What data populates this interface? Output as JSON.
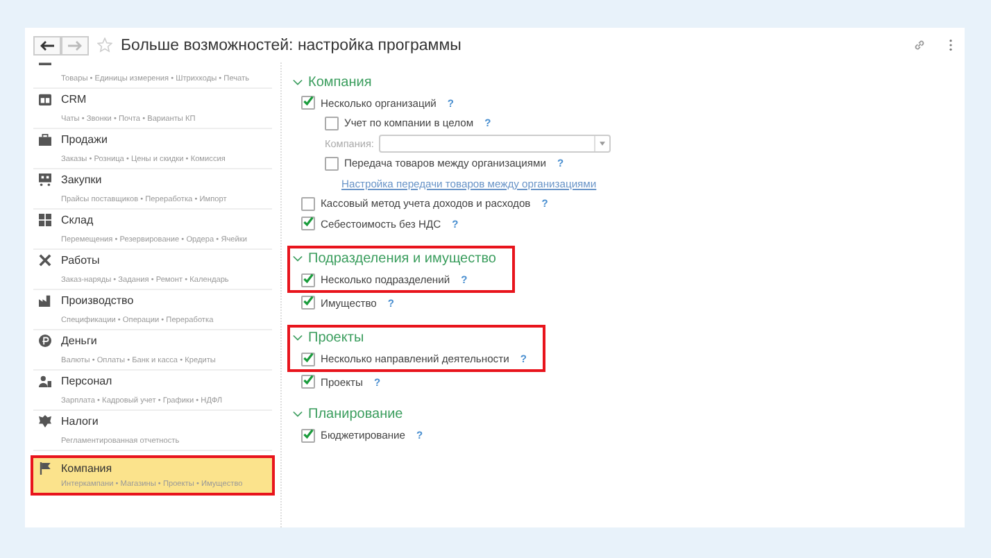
{
  "window": {
    "title": "Больше возможностей: настройка программы",
    "star": false
  },
  "sidebar": {
    "items": [
      {
        "subtitle": "Товары • Единицы измерения • Штрихкоды • Печать",
        "selected": false,
        "highlighted": false
      },
      {
        "title": "CRM",
        "subtitle": "Чаты • Звонки • Почта • Варианты КП",
        "selected": false,
        "highlighted": false
      },
      {
        "title": "Продажи",
        "subtitle": "Заказы • Розница • Цены и скидки • Комиссия",
        "selected": false,
        "highlighted": false
      },
      {
        "title": "Закупки",
        "subtitle": "Прайсы поставщиков • Переработка • Импорт",
        "selected": false,
        "highlighted": false
      },
      {
        "title": "Склад",
        "subtitle": "Перемещения • Резервирование • Ордера • Ячейки",
        "selected": false,
        "highlighted": false
      },
      {
        "title": "Работы",
        "subtitle": "Заказ-наряды • Задания • Ремонт • Календарь",
        "selected": false,
        "highlighted": false
      },
      {
        "title": "Производство",
        "subtitle": "Спецификации • Операции • Переработка",
        "selected": false,
        "highlighted": false
      },
      {
        "title": "Деньги",
        "subtitle": "Валюты • Оплаты • Банк и касса • Кредиты",
        "selected": false,
        "highlighted": false
      },
      {
        "title": "Персонал",
        "subtitle": "Зарплата • Кадровый учет • Графики • НДФЛ",
        "selected": false,
        "highlighted": false
      },
      {
        "title": "Налоги",
        "subtitle": "Регламентированная отчетность",
        "selected": false,
        "highlighted": false
      },
      {
        "title": "Компания",
        "subtitle": "Интеркампани • Магазины • Проекты • Имущество",
        "selected": true,
        "highlighted": true
      }
    ]
  },
  "sections": [
    {
      "title": "Компания",
      "expanded": true,
      "highlighted": false,
      "items": [
        {
          "kind": "checkbox",
          "label": "Несколько организаций",
          "checked": true,
          "help": "?",
          "children": [
            {
              "kind": "checkbox",
              "label": "Учет по компании в целом",
              "checked": false,
              "help": "?"
            },
            {
              "kind": "field",
              "label": "Компания:",
              "disabled": true
            },
            {
              "kind": "checkbox",
              "label": "Передача товаров между организациями",
              "checked": false,
              "help": "?"
            },
            {
              "kind": "link",
              "label": "Настройка передачи товаров между организациями"
            }
          ]
        },
        {
          "kind": "checkbox",
          "label": "Кассовый метод учета доходов и расходов",
          "checked": false,
          "help": "?"
        },
        {
          "kind": "checkbox",
          "label": "Себестоимость без НДС",
          "checked": true,
          "help": "?"
        }
      ]
    },
    {
      "title": "Подразделения и имущество",
      "expanded": true,
      "highlighted": true,
      "items": [
        {
          "kind": "checkbox",
          "label": "Несколько подразделений",
          "checked": true,
          "help": "?"
        },
        {
          "kind": "checkbox",
          "label": "Имущество",
          "checked": true,
          "help": "?"
        }
      ]
    },
    {
      "title": "Проекты",
      "expanded": true,
      "highlighted": true,
      "items": [
        {
          "kind": "checkbox",
          "label": "Несколько направлений деятельности",
          "checked": true,
          "help": "?"
        },
        {
          "kind": "checkbox",
          "label": "Проекты",
          "checked": true,
          "help": "?"
        }
      ]
    },
    {
      "title": "Планирование",
      "expanded": true,
      "highlighted": false,
      "items": [
        {
          "kind": "checkbox",
          "label": "Бюджетирование",
          "checked": true,
          "help": "?"
        }
      ]
    }
  ]
}
